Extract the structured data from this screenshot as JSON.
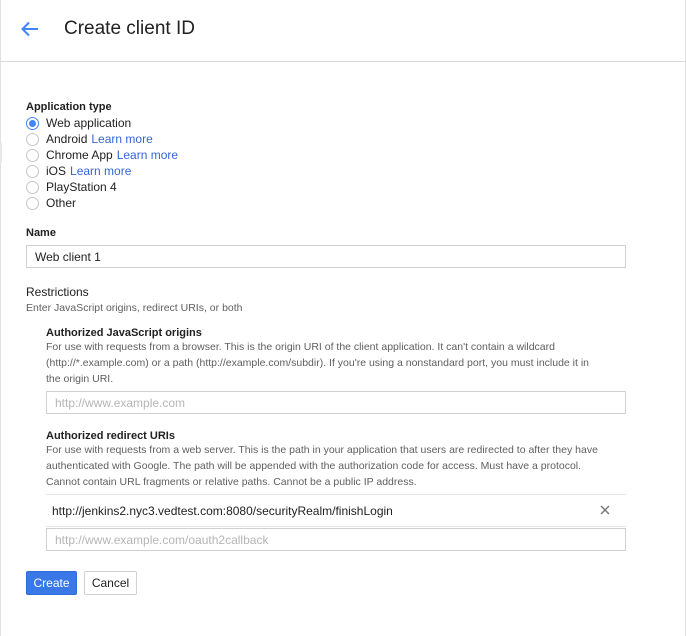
{
  "header": {
    "back_icon": "arrow-back-icon",
    "title": "Create client ID"
  },
  "application_type": {
    "label": "Application type",
    "selected": "Web application",
    "options": [
      {
        "label": "Web application",
        "link": ""
      },
      {
        "label": "Android",
        "link": "Learn more"
      },
      {
        "label": "Chrome App",
        "link": "Learn more"
      },
      {
        "label": "iOS",
        "link": "Learn more"
      },
      {
        "label": "PlayStation 4",
        "link": ""
      },
      {
        "label": "Other",
        "link": ""
      }
    ]
  },
  "name": {
    "label": "Name",
    "value": "Web client 1"
  },
  "restrictions": {
    "title": "Restrictions",
    "subtitle": "Enter JavaScript origins, redirect URIs, or both",
    "js_origins": {
      "label": "Authorized JavaScript origins",
      "help_lines": [
        "For use with requests from a browser. This is the origin URI of the client application. It can't contain a wildcard",
        "(http://*.example.com) or a path (http://example.com/subdir). If you're using a nonstandard port, you must include it in",
        "the origin URI."
      ],
      "placeholder": "http://www.example.com",
      "value": ""
    },
    "redirect_uris": {
      "label": "Authorized redirect URIs",
      "help_lines": [
        "For use with requests from a web server. This is the path in your application that users are redirected to after they have",
        "authenticated with Google. The path will be appended with the authorization code for access. Must have a protocol.",
        "Cannot contain URL fragments or relative paths. Cannot be a public IP address."
      ],
      "entries": [
        "http://jenkins2.nyc3.vedtest.com:8080/securityRealm/finishLogin"
      ],
      "remove_icon": "close-icon",
      "placeholder": "http://www.example.com/oauth2callback",
      "value": ""
    }
  },
  "actions": {
    "create_label": "Create",
    "cancel_label": "Cancel"
  },
  "colors": {
    "accent": "#4285f4",
    "primary_button": "#3b78e7",
    "link": "#3367d6"
  }
}
